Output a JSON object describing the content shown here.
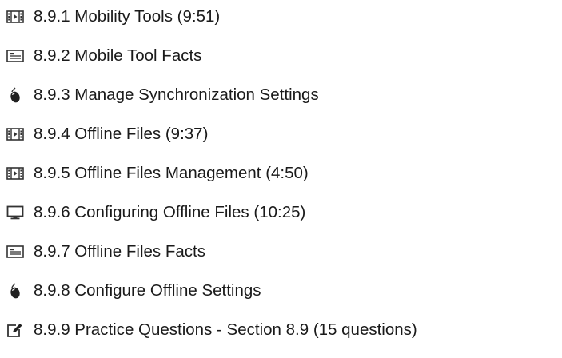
{
  "items": [
    {
      "icon": "video-icon",
      "label": "8.9.1 Mobility Tools (9:51)"
    },
    {
      "icon": "document-icon",
      "label": "8.9.2 Mobile Tool Facts"
    },
    {
      "icon": "mouse-icon",
      "label": "8.9.3 Manage Synchronization Settings"
    },
    {
      "icon": "video-icon",
      "label": "8.9.4 Offline Files (9:37)"
    },
    {
      "icon": "video-icon",
      "label": "8.9.5 Offline Files Management (4:50)"
    },
    {
      "icon": "monitor-icon",
      "label": "8.9.6 Configuring Offline Files (10:25)"
    },
    {
      "icon": "document-icon",
      "label": "8.9.7 Offline Files Facts"
    },
    {
      "icon": "mouse-icon",
      "label": "8.9.8 Configure Offline Settings"
    },
    {
      "icon": "edit-icon",
      "label": "8.9.9 Practice Questions - Section 8.9 (15 questions)"
    }
  ]
}
